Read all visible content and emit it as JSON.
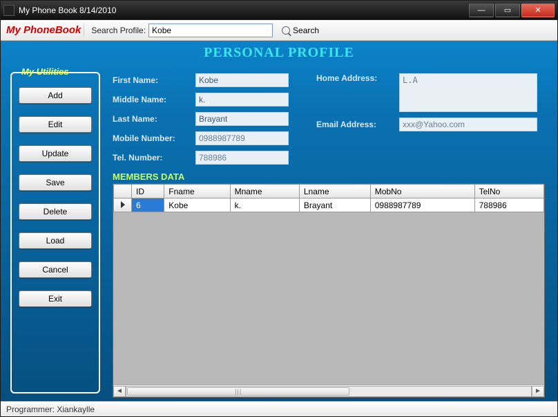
{
  "window": {
    "title": "My Phone Book 8/14/2010"
  },
  "toolbar": {
    "brand": "My PhoneBook",
    "search_label": "Search Profile:",
    "search_value": "Kobe",
    "search_btn": "Search"
  },
  "page": {
    "title": "PERSONAL PROFILE"
  },
  "sidebar": {
    "title": "My Utilities",
    "buttons": [
      "Add",
      "Edit",
      "Update",
      "Save",
      "Delete",
      "Load",
      "Cancel",
      "Exit"
    ]
  },
  "form": {
    "first_name_label": "First Name:",
    "first_name": "Kobe",
    "middle_name_label": "Middle Name:",
    "middle_name": "k.",
    "last_name_label": "Last Name:",
    "last_name": "Brayant",
    "mobile_label": "Mobile Number:",
    "mobile": "0988987789",
    "tel_label": "Tel. Number:",
    "tel": "788986",
    "home_label": "Home Address:",
    "home": "L.A",
    "email_label": "Email Address:",
    "email": "xxx@Yahoo.com"
  },
  "members": {
    "label": "MEMBERS DATA",
    "columns": [
      "ID",
      "Fname",
      "Mname",
      "Lname",
      "MobNo",
      "TelNo"
    ],
    "rows": [
      {
        "id": "6",
        "fname": "Kobe",
        "mname": "k.",
        "lname": "Brayant",
        "mobno": "0988987789",
        "telno": "788986"
      }
    ]
  },
  "status": {
    "text": "Programmer: Xiankaylle"
  }
}
